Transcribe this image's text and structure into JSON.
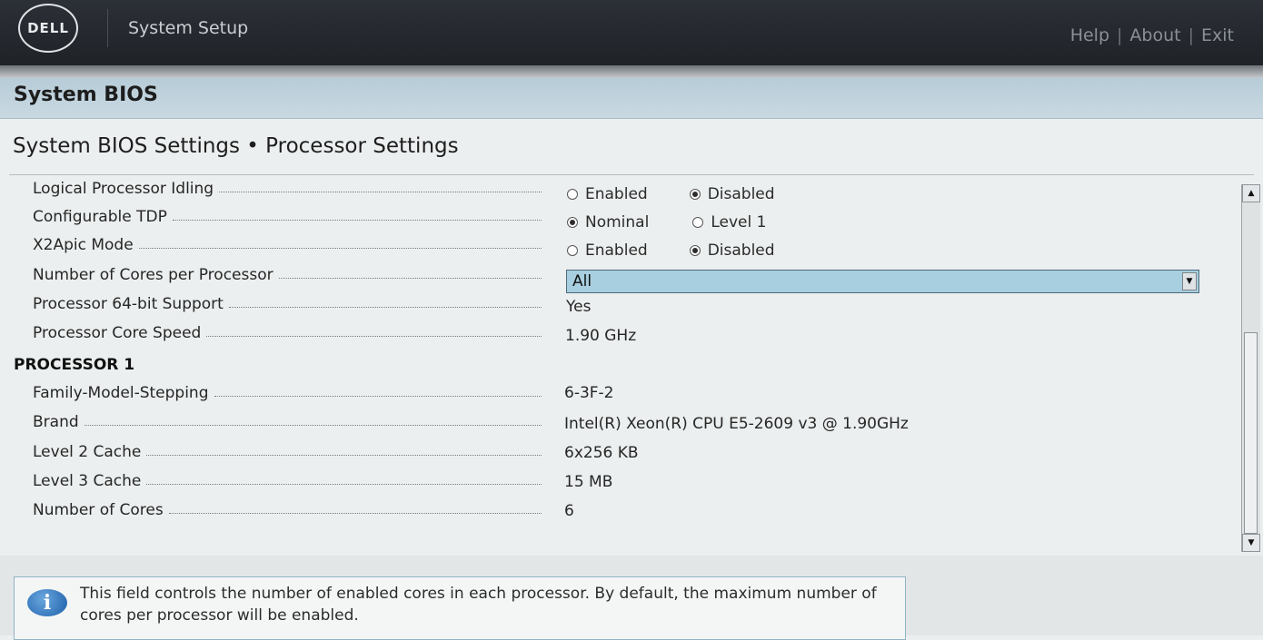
{
  "header": {
    "logo_text": "DELL",
    "app_title": "System Setup",
    "links": {
      "help": "Help",
      "about": "About",
      "exit": "Exit",
      "separator": "|"
    }
  },
  "section_title": "System BIOS",
  "breadcrumb": "System BIOS Settings • Processor Settings",
  "settings": {
    "logical_idling": {
      "label": "Logical Processor Idling",
      "opt1": "Enabled",
      "opt2": "Disabled",
      "selected": "Disabled"
    },
    "configurable_tdp": {
      "label": "Configurable TDP",
      "opt1": "Nominal",
      "opt2": "Level 1",
      "selected": "Nominal"
    },
    "x2apic": {
      "label": "X2Apic Mode",
      "opt1": "Enabled",
      "opt2": "Disabled",
      "selected": "Disabled"
    },
    "cores_per_processor": {
      "label": "Number of Cores per Processor",
      "value": "All"
    },
    "processor_64bit": {
      "label": "Processor 64-bit Support",
      "value": "Yes"
    },
    "core_speed": {
      "label": "Processor Core Speed",
      "value": "1.90 GHz"
    }
  },
  "processor1": {
    "heading": "PROCESSOR 1",
    "family": {
      "label": "Family-Model-Stepping",
      "value": "6-3F-2"
    },
    "brand": {
      "label": "Brand",
      "value": "Intel(R) Xeon(R) CPU E5-2609 v3 @ 1.90GHz"
    },
    "l2": {
      "label": "Level 2 Cache",
      "value": "6x256 KB"
    },
    "l3": {
      "label": "Level 3 Cache",
      "value": "15 MB"
    },
    "cores": {
      "label": "Number of Cores",
      "value": "6"
    }
  },
  "help": {
    "icon": "info-icon",
    "text": "This field controls the number of enabled cores in each processor. By default, the maximum number of cores per processor will be enabled."
  },
  "colors": {
    "header_bg": "#1f2227",
    "section_bg": "#b7ccd8",
    "dropdown_bg": "#a8cfe0",
    "help_border": "#8fb4c6"
  }
}
